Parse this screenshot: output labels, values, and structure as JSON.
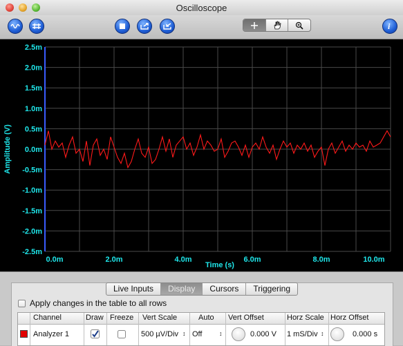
{
  "window": {
    "title": "Oscilloscope"
  },
  "toolbar": {
    "left_icons": [
      "waveform-icon",
      "bus-icon"
    ],
    "center_icons": [
      "stop-icon",
      "export-icon",
      "import-icon"
    ],
    "tool_icons": [
      "crosshair-icon",
      "hand-icon",
      "zoom-icon"
    ],
    "help_icon": "help-icon"
  },
  "chart_data": {
    "type": "line",
    "xlabel": "Time (s)",
    "ylabel": "Amplitude (V)",
    "xlim": [
      0,
      10
    ],
    "ylim": [
      -2.5,
      2.5
    ],
    "x_unit": "ms",
    "y_unit": "mV",
    "x_ticks": [
      "0.0m",
      "2.0m",
      "4.0m",
      "6.0m",
      "8.0m",
      "10.0m"
    ],
    "y_ticks": [
      "2.5m",
      "2.0m",
      "1.5m",
      "1.0m",
      "0.5m",
      "0.0m",
      "-0.5m",
      "-1.0m",
      "-1.5m",
      "-2.0m",
      "-2.5m"
    ],
    "grid": true,
    "colors": {
      "background": "#000000",
      "grid": "#4a4a4a",
      "axis_text": "#1fe6ea",
      "trace": "#ff1a1a",
      "left_axis": "#3a5cff"
    },
    "series": [
      {
        "x": [
          0.0,
          0.1,
          0.2,
          0.3,
          0.4,
          0.5,
          0.6,
          0.7,
          0.8,
          0.9,
          1.0,
          1.1,
          1.2,
          1.3,
          1.4,
          1.5,
          1.6,
          1.7,
          1.8,
          1.9,
          2.0,
          2.1,
          2.2,
          2.3,
          2.4,
          2.5,
          2.6,
          2.7,
          2.8,
          2.9,
          3.0,
          3.1,
          3.2,
          3.3,
          3.4,
          3.5,
          3.6,
          3.7,
          3.8,
          3.9,
          4.0,
          4.1,
          4.2,
          4.3,
          4.4,
          4.5,
          4.6,
          4.7,
          4.8,
          4.9,
          5.0,
          5.1,
          5.2,
          5.3,
          5.4,
          5.5,
          5.6,
          5.7,
          5.8,
          5.9,
          6.0,
          6.1,
          6.2,
          6.3,
          6.4,
          6.5,
          6.6,
          6.7,
          6.8,
          6.9,
          7.0,
          7.1,
          7.2,
          7.3,
          7.4,
          7.5,
          7.6,
          7.7,
          7.8,
          7.9,
          8.0,
          8.1,
          8.2,
          8.3,
          8.4,
          8.5,
          8.6,
          8.7,
          8.8,
          8.9,
          9.0,
          9.1,
          9.2,
          9.3,
          9.4,
          9.5,
          9.6,
          9.7,
          9.8,
          9.9,
          10.0
        ],
        "values": [
          0.1,
          0.45,
          0.0,
          0.2,
          0.05,
          0.15,
          -0.2,
          0.1,
          0.3,
          -0.1,
          0.0,
          -0.3,
          0.2,
          -0.4,
          0.1,
          0.25,
          -0.15,
          0.0,
          -0.25,
          0.3,
          0.05,
          -0.2,
          -0.35,
          -0.1,
          -0.45,
          -0.3,
          0.0,
          0.25,
          -0.1,
          -0.2,
          0.05,
          -0.35,
          -0.25,
          0.0,
          0.3,
          -0.05,
          0.25,
          -0.2,
          0.1,
          0.2,
          0.3,
          0.0,
          0.15,
          -0.15,
          0.05,
          0.35,
          0.0,
          0.2,
          0.1,
          -0.05,
          0.0,
          0.25,
          -0.2,
          -0.05,
          0.15,
          0.2,
          0.05,
          -0.15,
          0.1,
          -0.2,
          0.05,
          0.15,
          0.0,
          0.3,
          0.05,
          -0.1,
          0.1,
          -0.25,
          0.0,
          0.2,
          0.05,
          0.15,
          -0.1,
          0.1,
          0.0,
          0.15,
          -0.05,
          0.1,
          -0.2,
          -0.05,
          0.05,
          -0.4,
          0.0,
          0.15,
          -0.1,
          0.05,
          0.2,
          -0.05,
          0.1,
          0.0,
          0.15,
          0.05,
          0.1,
          -0.05,
          0.2,
          0.05,
          0.1,
          0.15,
          0.3,
          0.45,
          0.3
        ]
      }
    ]
  },
  "panel": {
    "tabs": [
      {
        "label": "Live Inputs",
        "active": false
      },
      {
        "label": "Display",
        "active": true
      },
      {
        "label": "Cursors",
        "active": false
      },
      {
        "label": "Triggering",
        "active": false
      }
    ],
    "apply_all_label": "Apply changes in the table to all rows",
    "columns": [
      "Channel",
      "Draw",
      "Freeze",
      "Vert Scale",
      "Auto",
      "Vert Offset",
      "Horz Scale",
      "Horz Offset"
    ],
    "row": {
      "color": "#e10000",
      "channel": "Analyzer 1",
      "draw": true,
      "freeze": false,
      "vert_scale": "500 µV/Div",
      "auto": "Off",
      "vert_offset": "0.000 V",
      "horz_scale": "1 mS/Div",
      "horz_offset": "0.000 s"
    }
  }
}
